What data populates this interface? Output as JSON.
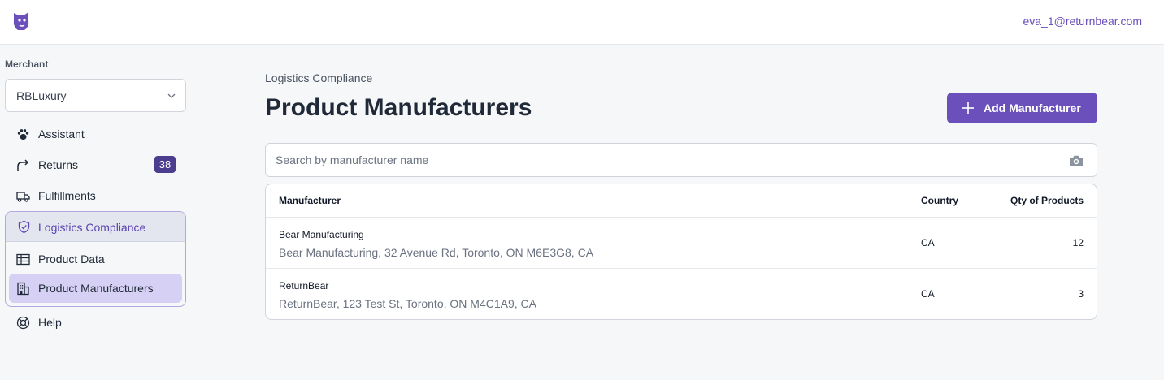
{
  "header": {
    "logo_icon": "bear-logo-icon",
    "user_email": "eva_1@returnbear.com"
  },
  "sidebar": {
    "merchant_label": "Merchant",
    "merchant_value": "RBLuxury",
    "items": [
      {
        "label": "Assistant",
        "icon": "paw-icon"
      },
      {
        "label": "Returns",
        "icon": "return-arrow-icon",
        "badge": "38"
      },
      {
        "label": "Fulfillments",
        "icon": "truck-icon"
      }
    ],
    "group": {
      "label": "Logistics Compliance",
      "icon": "shield-check-icon",
      "children": [
        {
          "label": "Product Data",
          "icon": "table-icon"
        },
        {
          "label": "Product Manufacturers",
          "icon": "building-icon",
          "active": true
        }
      ]
    },
    "help": {
      "label": "Help",
      "icon": "lifebuoy-icon"
    }
  },
  "main": {
    "breadcrumb": "Logistics Compliance",
    "title": "Product Manufacturers",
    "add_button_label": "Add Manufacturer",
    "search_placeholder": "Search by manufacturer name",
    "table": {
      "headers": {
        "manufacturer": "Manufacturer",
        "country": "Country",
        "qty": "Qty of Products"
      },
      "rows": [
        {
          "name": "Bear Manufacturing",
          "address": "Bear Manufacturing, 32 Avenue Rd, Toronto, ON M6E3G8, CA",
          "country": "CA",
          "qty": "12"
        },
        {
          "name": "ReturnBear",
          "address": "ReturnBear, 123 Test St, Toronto, ON M4C1A9, CA",
          "country": "CA",
          "qty": "3"
        }
      ]
    }
  },
  "colors": {
    "brand": "#6b4fbb",
    "badge": "#4c3d8f",
    "active_item": "#d6d0f4",
    "group_border": "#b3a7e0"
  }
}
